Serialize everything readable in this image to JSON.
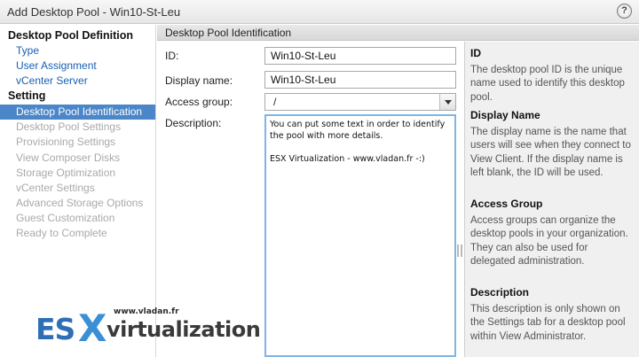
{
  "window": {
    "title": "Add Desktop Pool - Win10-St-Leu",
    "help_glyph": "?"
  },
  "sidebar": {
    "group1_title": "Desktop Pool Definition",
    "group1_items": [
      "Type",
      "User Assignment",
      "vCenter Server"
    ],
    "group2_title": "Setting",
    "group2_items": [
      "Desktop Pool Identification",
      "Desktop Pool Settings",
      "Provisioning Settings",
      "View Composer Disks",
      "Storage Optimization",
      "vCenter Settings",
      "Advanced Storage Options",
      "Guest Customization",
      "Ready to Complete"
    ],
    "selected": "Desktop Pool Identification"
  },
  "section": {
    "title": "Desktop Pool Identification"
  },
  "form": {
    "id_label": "ID:",
    "id_value": "Win10-St-Leu",
    "display_label": "Display name:",
    "display_value": "Win10-St-Leu",
    "access_label": "Access group:",
    "access_value": "/",
    "desc_label": "Description:",
    "desc_value": "You can put some text in order to identify\nthe pool with more details.\n\nESX Virtualization - www.vladan.fr -:)"
  },
  "help": {
    "id_title": "ID",
    "id_text": "The desktop pool ID is the unique name used to identify this desktop pool.",
    "display_title": "Display Name",
    "display_text": "The display name is the name that users will see when they connect to View Client. If the display name is left blank, the ID will be used.",
    "access_title": "Access Group",
    "access_text": "Access groups can organize the desktop pools in your organization. They can also be used for delegated administration.",
    "desc_title": "Description",
    "desc_text": "This description is only shown on the Settings tab for a desktop pool within View Administrator."
  },
  "watermark": {
    "url": "www.vladan.fr",
    "brand_es": "ES",
    "brand_x": "X",
    "brand_rest": "virtualization"
  },
  "colors": {
    "selected_bg": "#4a86c8",
    "link": "#1a5fb4",
    "disabled": "#a9a9a9",
    "help_bg": "#f0f0f0",
    "focus_border": "#7fb5e6"
  }
}
